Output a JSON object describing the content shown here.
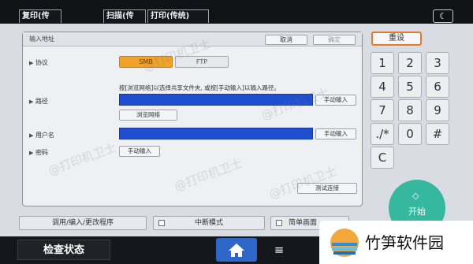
{
  "top_tabs": [
    {
      "label": "复印(传统)"
    },
    {
      "label": "扫描(传统)"
    },
    {
      "label": "打印(传统)"
    }
  ],
  "dialog": {
    "title": "输入地址",
    "cancel": "取消",
    "ok": "确定",
    "protocol_label": "协议",
    "protocol_smb": "SMB",
    "protocol_ftp": "FTP",
    "hint": "按[浏览网络]以选择共享文件夹, 或按[手动输入]以输入路径。",
    "path_label": "路径",
    "path_manual": "手动输入",
    "browse": "浏览网络",
    "user_label": "用户名",
    "user_manual": "手动输入",
    "pwd_label": "密码",
    "pwd_manual": "手动输入",
    "test": "测试连接"
  },
  "bottom_buttons": {
    "program": "调用/编入/更改程序",
    "interrupt": "中断模式",
    "simple": "简单画面"
  },
  "keypad": {
    "reset": "重设",
    "keys": [
      "1",
      "2",
      "3",
      "4",
      "5",
      "6",
      "7",
      "8",
      "9",
      "./*",
      "0",
      "#",
      "C"
    ],
    "start": "开始"
  },
  "footer": {
    "status": "检查状态",
    "home_icon": "home-icon",
    "menu_icon": "menu-icon"
  },
  "watermark": "@打印机卫士",
  "brand": "竹笋软件园"
}
